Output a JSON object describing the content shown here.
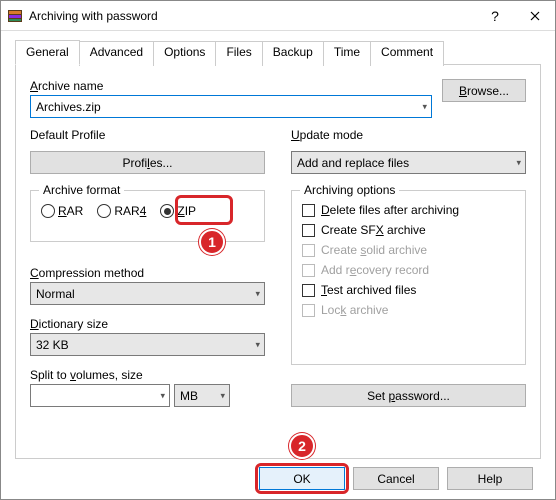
{
  "title": "Archiving with password",
  "tabs": [
    "General",
    "Advanced",
    "Options",
    "Files",
    "Backup",
    "Time",
    "Comment"
  ],
  "archive_name_label": "Archive name",
  "archive_name_value": "Archives.zip",
  "browse_label": "Browse...",
  "default_profile_label": "Default Profile",
  "profiles_btn": "Profiles...",
  "update_mode_label": "Update mode",
  "update_mode_value": "Add and replace files",
  "archive_format_label": "Archive format",
  "format_options": {
    "rar": "RAR",
    "rar4": "RAR4",
    "zip": "ZIP"
  },
  "compression_label": "Compression method",
  "compression_value": "Normal",
  "dictionary_label": "Dictionary size",
  "dictionary_value": "32 KB",
  "split_label": "Split to volumes, size",
  "split_value": "",
  "split_unit": "MB",
  "archiving_options_label": "Archiving options",
  "opts": {
    "delete": "Delete files after archiving",
    "sfx": "Create SFX archive",
    "solid": "Create solid archive",
    "recovery": "Add recovery record",
    "test": "Test archived files",
    "lock": "Lock archive"
  },
  "set_password_btn": "Set password...",
  "ok": "OK",
  "cancel": "Cancel",
  "help": "Help",
  "badge1": "1",
  "badge2": "2"
}
